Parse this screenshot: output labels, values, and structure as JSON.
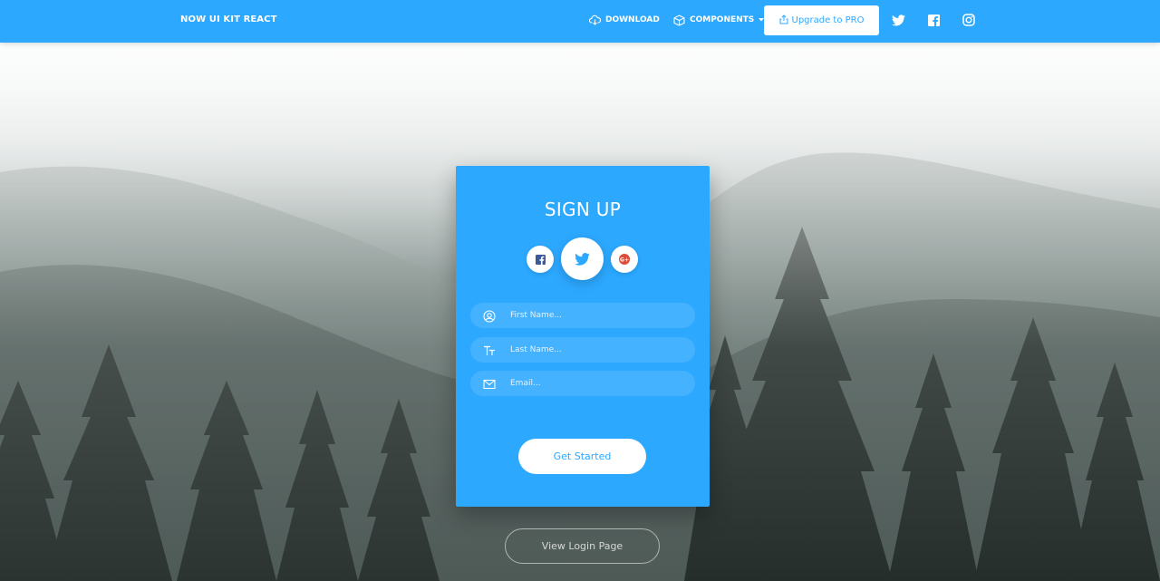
{
  "navbar": {
    "brand": "NOW UI KIT REACT",
    "download_label": "DOWNLOAD",
    "components_label": "COMPONENTS",
    "upgrade_label": "Upgrade to PRO"
  },
  "signup": {
    "title": "SIGN UP",
    "first_name_placeholder": "First Name...",
    "last_name_placeholder": "Last Name...",
    "email_placeholder": "Email...",
    "submit_label": "Get Started"
  },
  "footer": {
    "login_label": "View Login Page"
  },
  "colors": {
    "accent": "#2ca8ff",
    "google": "#dd4b39",
    "facebook": "#3b5998"
  },
  "icons": [
    "cloud-download-icon",
    "box-icon",
    "caret-down-icon",
    "share-icon",
    "twitter-icon",
    "facebook-icon",
    "instagram-icon",
    "google-plus-icon",
    "user-circle-icon",
    "text-icon",
    "email-icon"
  ]
}
